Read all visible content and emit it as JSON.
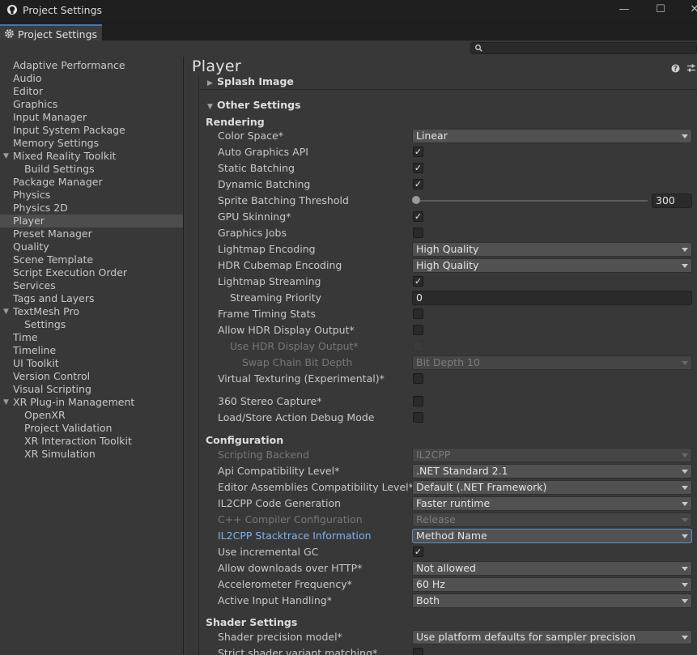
{
  "window": {
    "title": "Project Settings",
    "minimize": "—",
    "maximize": "☐",
    "close": "✕"
  },
  "tab": {
    "label": "Project Settings"
  },
  "search": {
    "placeholder": ""
  },
  "sidebar": {
    "items": [
      {
        "label": "Adaptive Performance",
        "indent": 0
      },
      {
        "label": "Audio",
        "indent": 0
      },
      {
        "label": "Editor",
        "indent": 0
      },
      {
        "label": "Graphics",
        "indent": 0
      },
      {
        "label": "Input Manager",
        "indent": 0
      },
      {
        "label": "Input System Package",
        "indent": 0
      },
      {
        "label": "Memory Settings",
        "indent": 0
      },
      {
        "label": "Mixed Reality Toolkit",
        "indent": 0,
        "fold": "▼"
      },
      {
        "label": "Build Settings",
        "indent": 1
      },
      {
        "label": "Package Manager",
        "indent": 0
      },
      {
        "label": "Physics",
        "indent": 0
      },
      {
        "label": "Physics 2D",
        "indent": 0
      },
      {
        "label": "Player",
        "indent": 0,
        "selected": true
      },
      {
        "label": "Preset Manager",
        "indent": 0
      },
      {
        "label": "Quality",
        "indent": 0
      },
      {
        "label": "Scene Template",
        "indent": 0
      },
      {
        "label": "Script Execution Order",
        "indent": 0
      },
      {
        "label": "Services",
        "indent": 0
      },
      {
        "label": "Tags and Layers",
        "indent": 0
      },
      {
        "label": "TextMesh Pro",
        "indent": 0,
        "fold": "▼"
      },
      {
        "label": "Settings",
        "indent": 1
      },
      {
        "label": "Time",
        "indent": 0
      },
      {
        "label": "Timeline",
        "indent": 0
      },
      {
        "label": "UI Toolkit",
        "indent": 0
      },
      {
        "label": "Version Control",
        "indent": 0
      },
      {
        "label": "Visual Scripting",
        "indent": 0
      },
      {
        "label": "XR Plug-in Management",
        "indent": 0,
        "fold": "▼"
      },
      {
        "label": "OpenXR",
        "indent": 1
      },
      {
        "label": "Project Validation",
        "indent": 1
      },
      {
        "label": "XR Interaction Toolkit",
        "indent": 1
      },
      {
        "label": "XR Simulation",
        "indent": 1
      }
    ]
  },
  "main": {
    "title": "Player",
    "splash": {
      "label": "Splash Image",
      "arrow": "▶"
    },
    "other": {
      "label": "Other Settings",
      "arrow": "▼"
    },
    "sections": {
      "rendering": "Rendering",
      "configuration": "Configuration",
      "shader": "Shader Settings"
    },
    "rows": [
      {
        "label": "Color Space*",
        "type": "dropdown",
        "value": "Linear"
      },
      {
        "label": "Auto Graphics API",
        "type": "checkbox",
        "checked": true
      },
      {
        "label": "Static Batching",
        "type": "checkbox",
        "checked": true
      },
      {
        "label": "Dynamic Batching",
        "type": "checkbox",
        "checked": true
      },
      {
        "label": "Sprite Batching Threshold",
        "type": "slider",
        "value": "300",
        "level": 0
      },
      {
        "label": "GPU Skinning*",
        "type": "checkbox",
        "checked": true
      },
      {
        "label": "Graphics Jobs",
        "type": "checkbox",
        "checked": false
      },
      {
        "label": "Lightmap Encoding",
        "type": "dropdown",
        "value": "High Quality"
      },
      {
        "label": "HDR Cubemap Encoding",
        "type": "dropdown",
        "value": "High Quality"
      },
      {
        "label": "Lightmap Streaming",
        "type": "checkbox",
        "checked": true
      },
      {
        "label": "Streaming Priority",
        "type": "text",
        "value": "0",
        "indent": 1
      },
      {
        "label": "Frame Timing Stats",
        "type": "checkbox",
        "checked": false
      },
      {
        "label": "Allow HDR Display Output*",
        "type": "checkbox",
        "checked": false
      },
      {
        "label": "Use HDR Display Output*",
        "type": "checkbox",
        "checked": false,
        "indent": 1,
        "disabled": true
      },
      {
        "label": "Swap Chain Bit Depth",
        "type": "dropdown",
        "value": "Bit Depth 10",
        "indent": 2,
        "disabled": true
      },
      {
        "label": "Virtual Texturing (Experimental)*",
        "type": "checkbox",
        "checked": false
      },
      {
        "label": "360 Stereo Capture*",
        "type": "checkbox",
        "checked": false
      },
      {
        "label": "Load/Store Action Debug Mode",
        "type": "checkbox",
        "checked": false
      },
      {
        "label": "Scripting Backend",
        "type": "dropdown",
        "value": "IL2CPP",
        "disabled": true
      },
      {
        "label": "Api Compatibility Level*",
        "type": "dropdown",
        "value": ".NET Standard 2.1"
      },
      {
        "label": "Editor Assemblies Compatibility Level*",
        "type": "dropdown",
        "value": "Default (.NET Framework)"
      },
      {
        "label": "IL2CPP Code Generation",
        "type": "dropdown",
        "value": "Faster runtime"
      },
      {
        "label": "C++ Compiler Configuration",
        "type": "dropdown",
        "value": "Release",
        "disabled": true
      },
      {
        "label": "IL2CPP Stacktrace Information",
        "type": "dropdown",
        "value": "Method Name",
        "focused": true
      },
      {
        "label": "Use incremental GC",
        "type": "checkbox",
        "checked": true
      },
      {
        "label": "Allow downloads over HTTP*",
        "type": "dropdown",
        "value": "Not allowed"
      },
      {
        "label": "Accelerometer Frequency*",
        "type": "dropdown",
        "value": "60 Hz"
      },
      {
        "label": "Active Input Handling*",
        "type": "dropdown",
        "value": "Both"
      },
      {
        "label": "Shader precision model*",
        "type": "dropdown",
        "value": "Use platform defaults for sampler precision"
      },
      {
        "label": "Strict shader variant matching*",
        "type": "checkbox",
        "checked": false
      }
    ]
  }
}
